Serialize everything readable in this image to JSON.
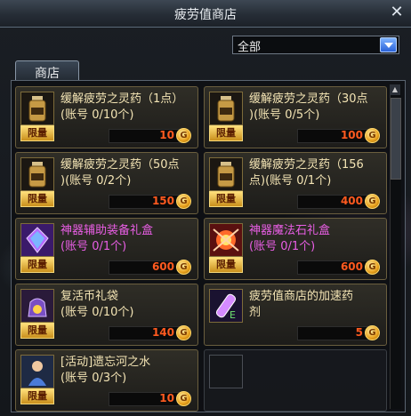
{
  "window": {
    "title": "疲劳值商店",
    "close_icon": "close-icon"
  },
  "filter": {
    "selected": "全部"
  },
  "tabs": [
    {
      "label": "商店"
    }
  ],
  "currency_glyph": "G",
  "limit_label": "限量",
  "items": [
    {
      "name_line1": "缓解疲劳之灵药（1点）",
      "name_line2": "(账号 0/10个)",
      "price": "10",
      "icon": "bottle-icon",
      "color": "#f3e4b4"
    },
    {
      "name_line1": "缓解疲劳之灵药（30点",
      "name_line2": ")(账号 0/5个)",
      "price": "100",
      "icon": "bottle-icon",
      "color": "#f3e4b4"
    },
    {
      "name_line1": "缓解疲劳之灵药（50点",
      "name_line2": ")(账号 0/2个)",
      "price": "150",
      "icon": "bottle-icon",
      "color": "#f3e4b4"
    },
    {
      "name_line1": "缓解疲劳之灵药（156",
      "name_line2": "点)(账号 0/1个)",
      "price": "400",
      "icon": "bottle-icon",
      "color": "#f3e4b4"
    },
    {
      "name_line1": "神器辅助装备礼盒",
      "name_line2": "(账号 0/1个)",
      "price": "600",
      "icon": "crystal-gift-icon",
      "color": "#e95ee5"
    },
    {
      "name_line1": "神器魔法石礼盒",
      "name_line2": "(账号 0/1个)",
      "price": "600",
      "icon": "magic-stone-gift-icon",
      "color": "#e95ee5"
    },
    {
      "name_line1": "复活币礼袋",
      "name_line2": "(账号 0/10个)",
      "price": "140",
      "icon": "coin-bag-icon",
      "color": "#f3e4b4"
    },
    {
      "name_line1": "疲劳值商店的加速药",
      "name_line2": "剂",
      "price": "5",
      "icon": "potion-vial-icon",
      "color": "#f3e4b4",
      "no_limit": true
    },
    {
      "name_line1": "[活动]遗忘河之水",
      "name_line2": "(账号 0/3个)",
      "price": "10",
      "icon": "character-icon",
      "color": "#f3e4b4"
    }
  ]
}
